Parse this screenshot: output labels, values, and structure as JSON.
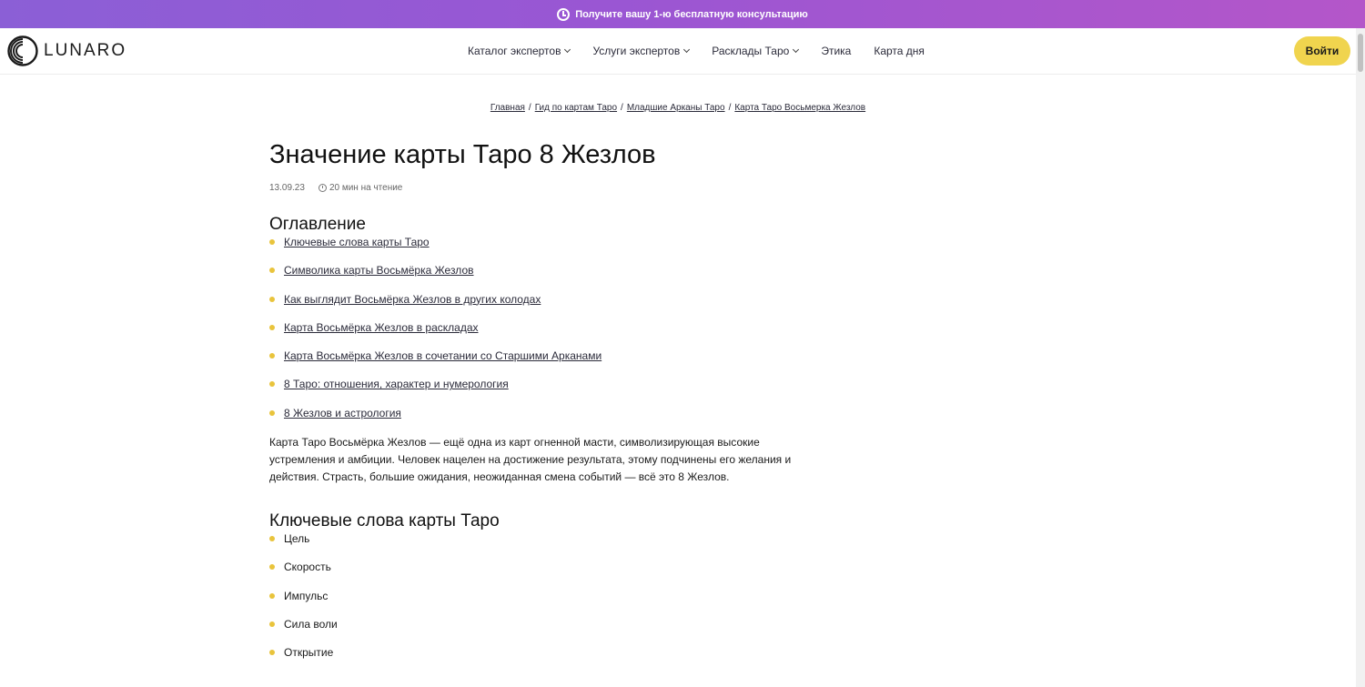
{
  "promo": {
    "text_before": "Получите вашу ",
    "text_bold": "1-ю бесплатную консультацию",
    "icon": "clock-icon"
  },
  "header": {
    "logo_text": "LUNARO",
    "nav": [
      {
        "label": "Каталог экспертов",
        "has_dropdown": true
      },
      {
        "label": "Услуги экспертов",
        "has_dropdown": true
      },
      {
        "label": "Расклады Таро",
        "has_dropdown": true
      },
      {
        "label": "Этика",
        "has_dropdown": false
      },
      {
        "label": "Карта дня",
        "has_dropdown": false
      }
    ],
    "login_label": "Войти"
  },
  "breadcrumb": {
    "items": [
      "Главная",
      "Гид по картам Таро",
      "Младшие Арканы Таро",
      "Карта Таро Восьмерка Жезлов"
    ],
    "separator": "/"
  },
  "article": {
    "title": "Значение карты Таро 8 Жезлов",
    "date": "13.09.23",
    "read_time": "20 мин на чтение",
    "toc_title": "Оглавление",
    "toc": [
      "Ключевые слова карты Таро",
      "Символика карты Восьмёрка Жезлов",
      "Как выглядит Восьмёрка Жезлов в других колодах",
      "Карта Восьмёрка Жезлов в раскладах",
      "Карта Восьмёрка Жезлов в сочетании со Старшими Арканами",
      "8 Таро: отношения, характер и нумерология",
      "8 Жезлов и астрология"
    ],
    "intro": "Карта Таро Восьмёрка Жезлов — ещё одна из карт огненной масти, символизирующая высокие устремления и амбиции. Человек нацелен на достижение результата, этому подчинены его желания и действия. Страсть, большие ожидания, неожиданная смена событий — всё это 8 Жезлов.",
    "keywords_title": "Ключевые слова карты Таро",
    "keywords": [
      "Цель",
      "Скорость",
      "Импульс",
      "Сила воли",
      "Открытие"
    ]
  },
  "colors": {
    "promo_gradient_start": "#8b5fd6",
    "promo_gradient_end": "#b456c9",
    "accent_yellow": "#f0d44e",
    "bullet": "#e9c43c"
  }
}
